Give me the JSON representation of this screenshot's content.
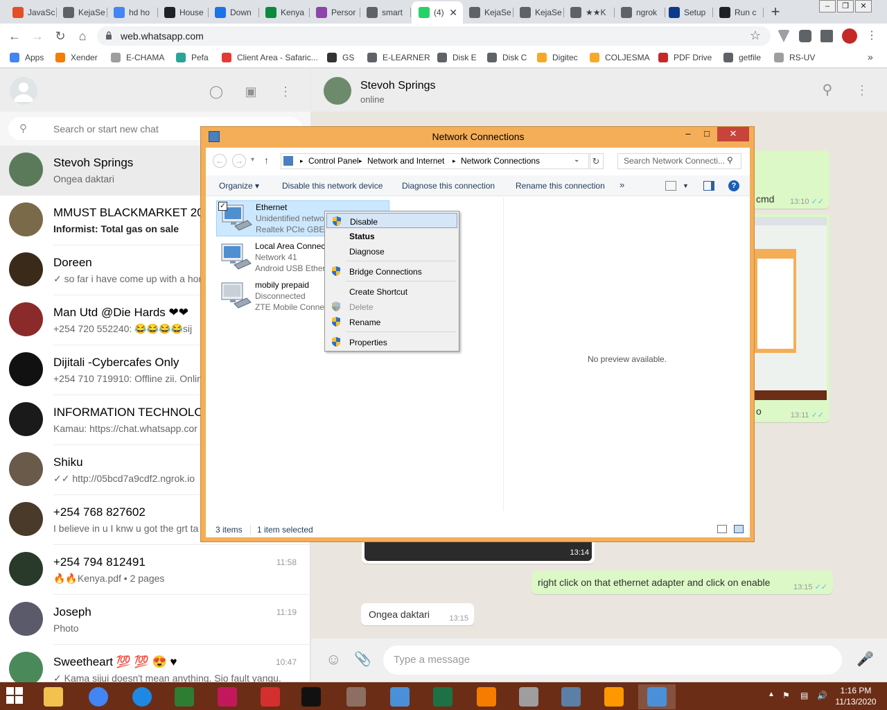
{
  "browser": {
    "tabs": [
      {
        "label": "JavaSc",
        "color": "#e44d26"
      },
      {
        "label": "KejaSe",
        "color": "#5f6368"
      },
      {
        "label": "hd ho",
        "color": "#4285f4"
      },
      {
        "label": "House",
        "color": "#202124"
      },
      {
        "label": "Down",
        "color": "#1a73e8"
      },
      {
        "label": "Kenya",
        "color": "#0a8a3a"
      },
      {
        "label": "Persor",
        "color": "#8e44ad"
      },
      {
        "label": "smart",
        "color": "#5f6368"
      },
      {
        "label": "(4)",
        "color": "#25d366",
        "active": true
      },
      {
        "label": "KejaSe",
        "color": "#5f6368"
      },
      {
        "label": "KejaSe",
        "color": "#5f6368"
      },
      {
        "label": "★★K",
        "color": "#5f6368"
      },
      {
        "label": "ngrok",
        "color": "#5f6368"
      },
      {
        "label": "Setup",
        "color": "#0b3a8a"
      },
      {
        "label": "Run c",
        "color": "#202124"
      }
    ],
    "new_tab": "+",
    "url": "web.whatsapp.com",
    "bookmarks": [
      {
        "label": "Apps",
        "color": "#4285f4"
      },
      {
        "label": "Xender",
        "color": "#f57c00"
      },
      {
        "label": "E-CHAMA",
        "color": "#9e9e9e"
      },
      {
        "label": "Pefa",
        "color": "#26a69a"
      },
      {
        "label": "Client Area - Safaric...",
        "color": "#e53935"
      },
      {
        "label": "GS",
        "color": "#333333"
      },
      {
        "label": "E-LEARNER",
        "color": "#5f6368"
      },
      {
        "label": "Disk E",
        "color": "#5f6368"
      },
      {
        "label": "Disk C",
        "color": "#5f6368"
      },
      {
        "label": "Digitec",
        "color": "#f9a825"
      },
      {
        "label": "COLJESMA",
        "color": "#f9a825"
      },
      {
        "label": "PDF Drive",
        "color": "#c62828"
      },
      {
        "label": "getfile",
        "color": "#5f6368"
      },
      {
        "label": "RS-UV",
        "color": "#9e9e9e"
      }
    ],
    "overflow": "»"
  },
  "whatsapp": {
    "search_placeholder": "Search or start new chat",
    "chats": [
      {
        "name": "Stevoh Springs",
        "snippet": "Ongea daktari",
        "time": "",
        "bold": false,
        "avatar": "#5a7a5a",
        "selected": true
      },
      {
        "name": "MMUST BLACKMARKET 2020",
        "snippet": "Informist: Total gas on sale",
        "time": "",
        "bold": true,
        "avatar": "#7a6a4a"
      },
      {
        "name": "Doreen",
        "snippet": "✓ so far i have come up with a hor",
        "time": "",
        "bold": false,
        "avatar": "#3a2a1a"
      },
      {
        "name": "Man Utd @Die Hards ❤❤",
        "snippet": "+254 720 552240: 😂😂😂😂sij",
        "time": "",
        "bold": false,
        "avatar": "#8a2a2a"
      },
      {
        "name": "Dijitali -Cybercafes Only",
        "snippet": "+254 710 719910: Offline zii. Onlin",
        "time": "",
        "bold": false,
        "avatar": "#111111"
      },
      {
        "name": "INFORMATION TECHNOLOGY",
        "snippet": "Kamau: https://chat.whatsapp.cor",
        "time": "",
        "bold": false,
        "avatar": "#1a1a1a"
      },
      {
        "name": "Shiku",
        "snippet": "✓✓ http://05bcd7a9cdf2.ngrok.io",
        "time": "",
        "bold": false,
        "avatar": "#6a5a4a"
      },
      {
        "name": "+254 768 827602",
        "snippet": "I believe in u I knw u got the grt ta",
        "time": "",
        "bold": false,
        "avatar": "#4a3a2a"
      },
      {
        "name": "+254 794 812491",
        "snippet": "🔥🔥Kenya.pdf • 2 pages",
        "time": "11:58",
        "bold": false,
        "avatar": "#2a3a2a"
      },
      {
        "name": "Joseph",
        "snippet": "Photo",
        "time": "11:19",
        "bold": false,
        "avatar": "#5a5a6a"
      },
      {
        "name": "Sweetheart 💯 💯 😍 ♥",
        "snippet": "✓ Kama sijui doesn't mean anything. Sio fault yangu.",
        "time": "10:47",
        "bold": false,
        "avatar": "#4a8a5a"
      }
    ],
    "contact": {
      "name": "Stevoh Springs",
      "status": "online"
    },
    "messages": [
      {
        "text": "cmd",
        "time": "13:10"
      },
      {
        "text": "o",
        "time": "13:11"
      },
      {
        "text": "",
        "time": "13:14"
      },
      {
        "text": "right click on that ethernet adapter and click on enable",
        "time": "13:15"
      },
      {
        "text": "Ongea daktari",
        "time": "13:15"
      }
    ],
    "input_placeholder": "Type a message"
  },
  "network_window": {
    "title": "Network Connections",
    "breadcrumb": [
      "Control Panel",
      "Network and Internet",
      "Network Connections"
    ],
    "search_placeholder": "Search Network Connecti...",
    "commands": [
      "Organize ▾",
      "Disable this network device",
      "Diagnose this connection",
      "Rename this connection",
      "»"
    ],
    "adapters": [
      {
        "name": "Ethernet",
        "status": "Unidentified network",
        "device": "Realtek PCIe GBE Fa",
        "selected": true
      },
      {
        "name": "Local Area Connection",
        "status": "Network 41",
        "device": "Android USB Ethern",
        "selected": false
      },
      {
        "name": "mobily prepaid",
        "status": "Disconnected",
        "device": "ZTE Mobile Connect",
        "selected": false
      }
    ],
    "preview_text": "No preview available.",
    "status_items": "3 items",
    "status_selected": "1 item selected"
  },
  "context_menu": [
    {
      "label": "Disable",
      "shield": true,
      "highlight": true
    },
    {
      "label": "Status",
      "bold": true
    },
    {
      "label": "Diagnose"
    },
    {
      "separator": true
    },
    {
      "label": "Bridge Connections",
      "shield": true
    },
    {
      "separator": true
    },
    {
      "label": "Create Shortcut"
    },
    {
      "label": "Delete",
      "shield": true,
      "disabled": true
    },
    {
      "label": "Rename",
      "shield": true
    },
    {
      "separator": true
    },
    {
      "label": "Properties",
      "shield": true
    }
  ],
  "taskbar": {
    "apps": [
      {
        "name": "file-explorer",
        "color": "#f2c14e"
      },
      {
        "name": "chrome",
        "color": "#4285f4"
      },
      {
        "name": "edge",
        "color": "#1e88e5"
      },
      {
        "name": "store",
        "color": "#2e7d32"
      },
      {
        "name": "camera",
        "color": "#c2185b"
      },
      {
        "name": "pdf",
        "color": "#d32f2f"
      },
      {
        "name": "cmd",
        "color": "#111111"
      },
      {
        "name": "paint",
        "color": "#8d6e63"
      },
      {
        "name": "photos",
        "color": "#4a90d9"
      },
      {
        "name": "excel",
        "color": "#1e7145"
      },
      {
        "name": "vlc",
        "color": "#f57c00"
      },
      {
        "name": "installer",
        "color": "#9e9e9e"
      },
      {
        "name": "network",
        "color": "#5b7fa6"
      },
      {
        "name": "sublime",
        "color": "#ff9800"
      },
      {
        "name": "control-panel",
        "color": "#4a90d9"
      }
    ],
    "time": "1:16 PM",
    "date": "11/13/2020"
  }
}
